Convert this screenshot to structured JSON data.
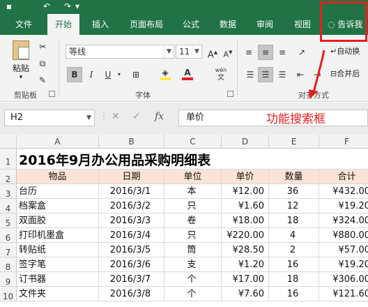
{
  "ribbon_tabs": [
    "文件",
    "开始",
    "插入",
    "页面布局",
    "公式",
    "数据",
    "审阅",
    "视图"
  ],
  "tell_me": "告诉我",
  "font": {
    "name": "等线",
    "size": "11"
  },
  "labels": {
    "paste": "粘贴",
    "clipboard": "剪贴板",
    "font": "字体",
    "alignment": "对齐方式",
    "wrap_text": "自动换",
    "merge": "合并后",
    "wen": "wén"
  },
  "formula_bar": {
    "name_box": "H2",
    "fx": "fx",
    "content": "单价"
  },
  "annotation": "功能搜索框",
  "colors": {
    "excel_green": "#217346",
    "annotation_red": "#e81e1e",
    "header_fill": "#fbe4d5"
  },
  "columns": [
    "A",
    "B",
    "C",
    "D",
    "E",
    "F"
  ],
  "rows": [
    "1",
    "2",
    "3",
    "4",
    "5",
    "6",
    "7",
    "8",
    "9",
    "10"
  ],
  "sheet": {
    "title": "2016年9月办公用品采购明细表",
    "headers": [
      "物品",
      "日期",
      "单位",
      "单价",
      "数量",
      "合计"
    ],
    "data": [
      [
        "台历",
        "2016/3/1",
        "本",
        "¥12.00",
        "36",
        "¥432.00"
      ],
      [
        "档案盒",
        "2016/3/2",
        "只",
        "¥1.60",
        "12",
        "¥19.20"
      ],
      [
        "双面胶",
        "2016/3/3",
        "卷",
        "¥18.00",
        "18",
        "¥324.00"
      ],
      [
        "打印机墨盒",
        "2016/3/4",
        "只",
        "¥220.00",
        "4",
        "¥880.00"
      ],
      [
        "转贴纸",
        "2016/3/5",
        "筒",
        "¥28.50",
        "2",
        "¥57.00"
      ],
      [
        "签字笔",
        "2016/3/6",
        "支",
        "¥1.20",
        "16",
        "¥19.20"
      ],
      [
        "订书器",
        "2016/3/7",
        "个",
        "¥17.00",
        "18",
        "¥306.00"
      ],
      [
        "文件夹",
        "2016/3/8",
        "个",
        "¥7.60",
        "16",
        "¥121.60"
      ]
    ]
  }
}
